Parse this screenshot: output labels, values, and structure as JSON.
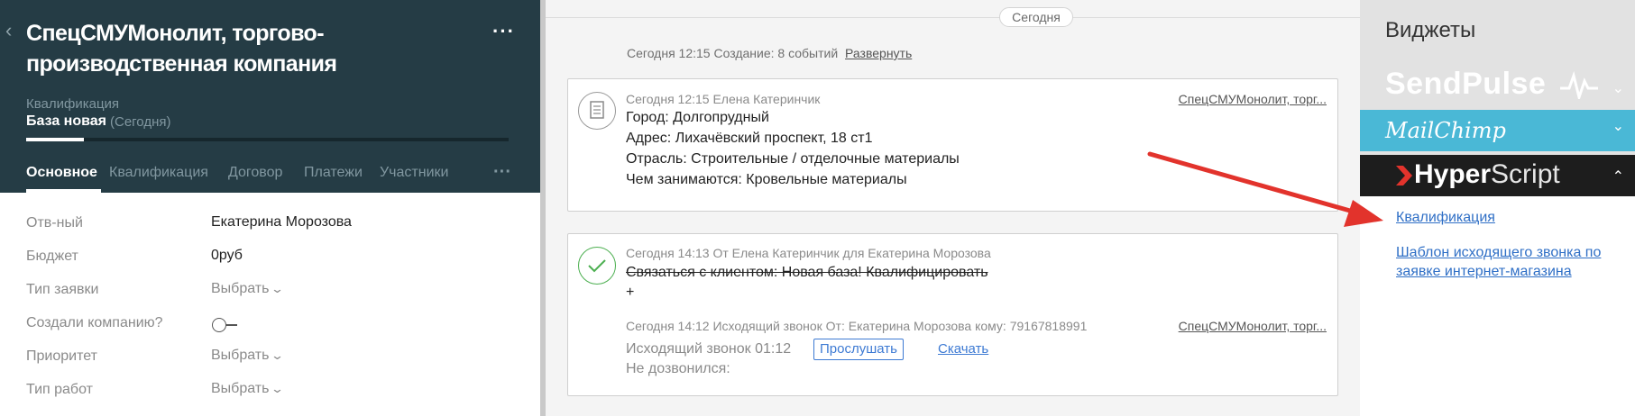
{
  "lead": {
    "back_icon": "chevron-left-icon",
    "company": "СпецСМУМонолит, торгово-производственная компания",
    "menu_icon": "more-horizontal-icon",
    "stage_caption": "Квалификация",
    "stage_value": "База новая",
    "stage_sub": "(Сегодня)",
    "stage_progress": 0.12
  },
  "tabs": [
    "Основное",
    "Квалификация",
    "Договор",
    "Платежи",
    "Участники"
  ],
  "fields": [
    {
      "label": "Отв-ный",
      "value": "Екатерина Морозова",
      "kind": "text"
    },
    {
      "label": "Бюджет",
      "value": "0руб",
      "kind": "text"
    },
    {
      "label": "Тип заявки",
      "value": "Выбрать",
      "kind": "select"
    },
    {
      "label": "Создали компанию?",
      "value": "",
      "kind": "toggle"
    },
    {
      "label": "Приоритет",
      "value": "Выбрать",
      "kind": "select"
    },
    {
      "label": "Тип работ",
      "value": "Выбрать",
      "kind": "select"
    }
  ],
  "feed": {
    "day": "Сегодня",
    "created": "Сегодня 12:15 Создание: 8 событий",
    "expand": "Развернуть",
    "note": {
      "meta": "Сегодня 12:15 Елена Катеринчик",
      "link": "СпецСМУМонолит, торг...",
      "lines": [
        "Город: Долгопрудный",
        "Адрес: Лихачёвский проспект, 18 ст1",
        "Отрасль: Строительные / отделочные материалы",
        "Чем занимаются: Кровельные материалы"
      ]
    },
    "task": {
      "meta": "Сегодня 14:13  От Елена Катеринчик для Екатерина Морозова",
      "text": "Связаться с клиентом: Новая база! Квалифицировать",
      "plus": "+",
      "call_meta": "Сегодня 14:12  Исходящий звонок От: Екатерина Морозова  кому: 79167818991",
      "call_link": "СпецСМУМонолит, торг...",
      "call_line": "Исходящий звонок 01:12",
      "listen": "Прослушать",
      "download": "Скачать",
      "result": "Не дозвонился:"
    }
  },
  "widgets": {
    "title": "Виджеты",
    "sendpulse": "SendPulse",
    "mailchimp": "MailChimp",
    "hyperscript_a": "Hyper",
    "hyperscript_b": "Script",
    "links": [
      "Квалификация",
      "Шаблон исходящего звонка по заявке интернет-магазина"
    ]
  },
  "colors": {
    "header_bg": "#253c45",
    "mailchimp": "#4ab8d6",
    "hyperscript": "#1d1d1d",
    "accent": "#2f6fc6",
    "annotation_arrow": "#e2332c"
  }
}
